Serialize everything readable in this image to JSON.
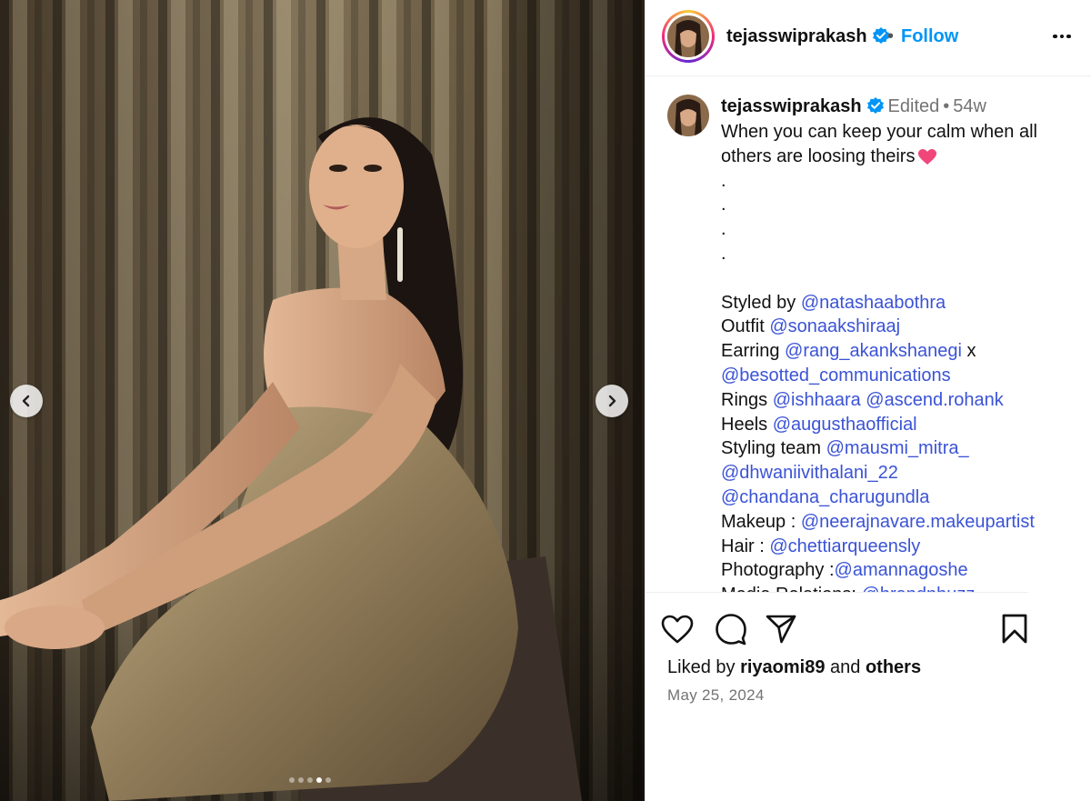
{
  "header": {
    "username": "tejasswiprakash",
    "separator": "•",
    "follow_label": "Follow"
  },
  "caption": {
    "username": "tejasswiprakash",
    "edited": "Edited",
    "dot": "•",
    "time": "54w",
    "line1": "When you can keep your calm when all",
    "line2": "others are loosing theirs",
    "dots": [
      ".",
      ".",
      ".",
      "."
    ],
    "credits": {
      "styled_label": "Styled by ",
      "styled_handle": "@natashaabothra",
      "outfit_label": "Outfit ",
      "outfit_handle": "@sonaakshiraaj",
      "earring_label": "Earring ",
      "earring_handle": "@rang_akankshanegi",
      "earring_x": " x",
      "earring_handle2": "@besotted_communications",
      "rings_label": "Rings ",
      "rings_handle1": "@ishhaara",
      "rings_handle2": "@ascend.rohank",
      "heels_label": "Heels ",
      "heels_handle": "@augusthaofficial",
      "team_label": "Styling team ",
      "team_handle1": "@mausmi_mitra_",
      "team_handle2": "@dhwaniivithalani_22",
      "team_handle3": "@chandana_charugundla",
      "makeup_label": "Makeup : ",
      "makeup_handle": "@neerajnavare.makeupartist",
      "hair_label": "Hair : ",
      "hair_handle": "@chettiarqueensly",
      "photo_label": "Photography :",
      "photo_handle": "@amannagoshe",
      "media_label": "Media Relations: ",
      "media_handle": "@brandnbuzz"
    }
  },
  "footer": {
    "liked_prefix": "Liked by ",
    "liked_user": "riyaomi89",
    "liked_and": " and ",
    "liked_others": "others",
    "date": "May 25, 2024"
  },
  "carousel": {
    "slide_count": 5,
    "active_index": 3
  },
  "icons": {
    "verified": "verified-badge-icon",
    "more": "more-options-icon",
    "like": "heart-icon",
    "comment": "comment-icon",
    "share": "share-icon",
    "save": "bookmark-icon",
    "prev": "chevron-left-icon",
    "next": "chevron-right-icon",
    "emoji": "pink-heart-emoji"
  },
  "colors": {
    "link": "#3b53d6",
    "follow": "#0095f6",
    "verified": "#0095f6",
    "muted": "#737373"
  }
}
